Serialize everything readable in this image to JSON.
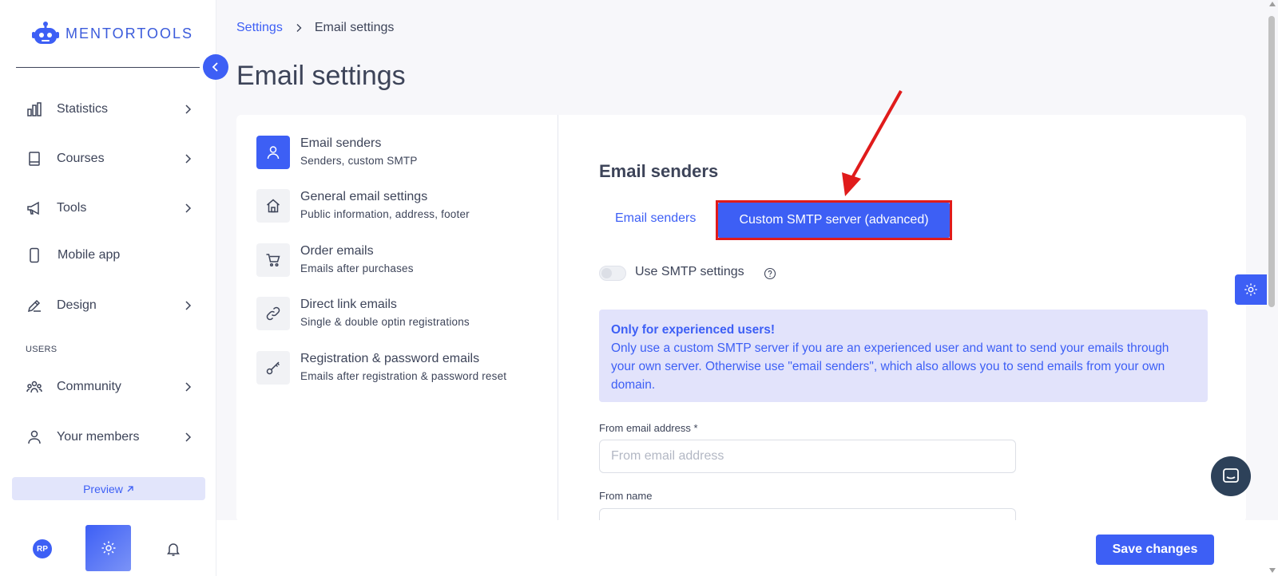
{
  "brand": {
    "name": "MENTORTOOLS",
    "accent_color": "#3d5ff5"
  },
  "sidebar": {
    "collapse_icon": "chevron-left-icon",
    "items": [
      {
        "label": "Statistics",
        "icon": "bar-chart-icon",
        "has_chevron": true
      },
      {
        "label": "Courses",
        "icon": "book-icon",
        "has_chevron": true
      },
      {
        "label": "Tools",
        "icon": "megaphone-icon",
        "has_chevron": true
      },
      {
        "label": "Mobile app",
        "icon": "phone-icon",
        "has_chevron": false
      },
      {
        "label": "Design",
        "icon": "pencil-icon",
        "has_chevron": true
      }
    ],
    "users_section_label": "USERS",
    "user_items": [
      {
        "label": "Community",
        "icon": "group-icon",
        "has_chevron": true
      },
      {
        "label": "Your members",
        "icon": "user-icon",
        "has_chevron": true
      }
    ],
    "preview_label": "Preview",
    "avatar_initials": "RP"
  },
  "breadcrumb": {
    "parent": "Settings",
    "current": "Email settings"
  },
  "page_title": "Email settings",
  "settings_menu": [
    {
      "title": "Email senders",
      "subtitle": "Senders, custom SMTP",
      "icon": "user-icon",
      "active": true
    },
    {
      "title": "General email settings",
      "subtitle": "Public information, address, footer",
      "icon": "home-icon",
      "active": false
    },
    {
      "title": "Order emails",
      "subtitle": "Emails after purchases",
      "icon": "cart-icon",
      "active": false
    },
    {
      "title": "Direct link emails",
      "subtitle": "Single & double optin registrations",
      "icon": "link-icon",
      "active": false
    },
    {
      "title": "Registration & password emails",
      "subtitle": "Emails after registration & password reset",
      "icon": "key-icon",
      "active": false
    }
  ],
  "panel": {
    "title": "Email senders",
    "tabs": [
      {
        "label": "Email senders",
        "active": false
      },
      {
        "label": "Custom SMTP server (advanced)",
        "active": true
      }
    ],
    "smtp_toggle": {
      "label": "Use SMTP settings",
      "enabled": false
    },
    "notice": {
      "title": "Only for experienced users!",
      "body": "Only use a custom SMTP server if you are an experienced user and want to send your emails through your own server. Otherwise use \"email senders\", which also allows you to send emails from your own domain."
    },
    "fields": {
      "from_email": {
        "label": "From email address *",
        "placeholder": "From email address",
        "value": ""
      },
      "from_name": {
        "label": "From name",
        "placeholder": "",
        "value": ""
      }
    }
  },
  "footer": {
    "save_label": "Save changes"
  },
  "annotation": {
    "color": "#e01b1b"
  }
}
